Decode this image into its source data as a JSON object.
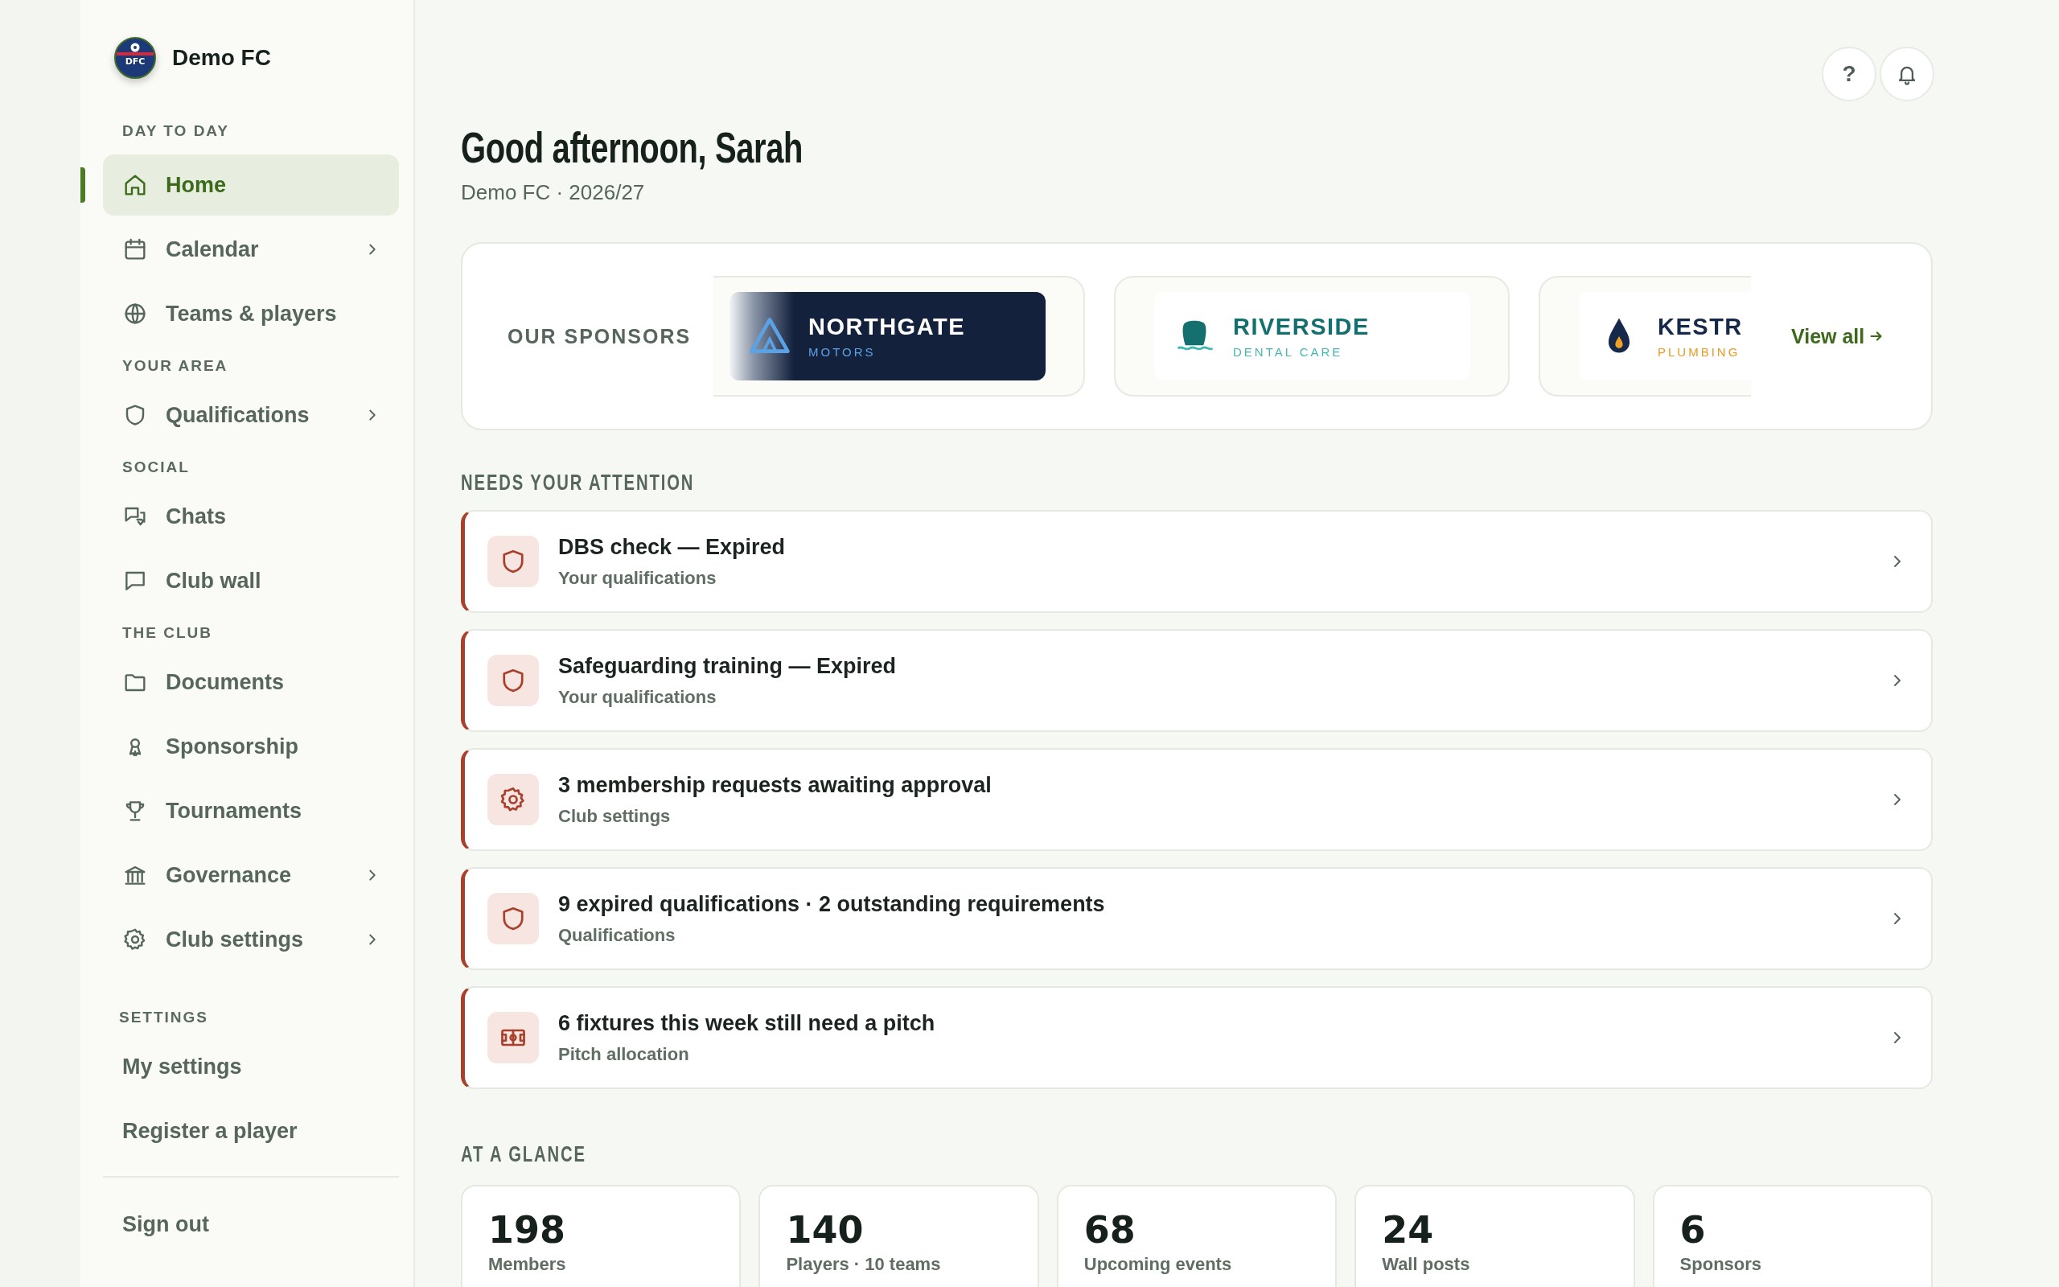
{
  "club": {
    "name": "Demo FC",
    "badge_text": "DFC"
  },
  "nav_sections": [
    {
      "heading": "DAY TO DAY",
      "items": [
        {
          "label": "Home",
          "selected": true,
          "has_submenu": false
        },
        {
          "label": "Calendar",
          "selected": false,
          "has_submenu": true
        },
        {
          "label": "Teams & players",
          "selected": false,
          "has_submenu": false
        }
      ]
    },
    {
      "heading": "YOUR AREA",
      "items": [
        {
          "label": "Qualifications",
          "selected": false,
          "has_submenu": true
        }
      ]
    },
    {
      "heading": "SOCIAL",
      "items": [
        {
          "label": "Chats",
          "selected": false,
          "has_submenu": false
        },
        {
          "label": "Club wall",
          "selected": false,
          "has_submenu": false
        }
      ]
    },
    {
      "heading": "THE CLUB",
      "items": [
        {
          "label": "Documents",
          "selected": false,
          "has_submenu": false
        },
        {
          "label": "Sponsorship",
          "selected": false,
          "has_submenu": false
        },
        {
          "label": "Tournaments",
          "selected": false,
          "has_submenu": false
        },
        {
          "label": "Governance",
          "selected": false,
          "has_submenu": true
        },
        {
          "label": "Club settings",
          "selected": false,
          "has_submenu": true
        }
      ]
    },
    {
      "heading": "SETTINGS",
      "items": [
        {
          "label": "My settings",
          "selected": false,
          "has_submenu": false
        },
        {
          "label": "Register a player",
          "selected": false,
          "has_submenu": false
        }
      ]
    }
  ],
  "sign_out": {
    "label": "Sign out"
  },
  "top_actions": {
    "help_label": "?"
  },
  "header": {
    "greeting": "Good afternoon, Sarah",
    "subtitle": "Demo FC · 2026/27"
  },
  "sponsors": {
    "heading": "OUR SPONSORS",
    "view_all": "View all",
    "items": [
      {
        "kind": "dark",
        "name": "NORTHGATE",
        "tagline": "MOTORS"
      },
      {
        "kind": "light",
        "name": "RIVERSIDE",
        "tagline": "DENTAL CARE"
      },
      {
        "kind": "light",
        "name": "KESTR",
        "tagline": "PLUMBING"
      }
    ]
  },
  "attention": {
    "heading": "NEEDS YOUR ATTENTION",
    "items": [
      {
        "title": "DBS check — Expired",
        "subtitle": "Your qualifications"
      },
      {
        "title": "Safeguarding training — Expired",
        "subtitle": "Your qualifications"
      },
      {
        "title": "3 membership requests awaiting approval",
        "subtitle": "Club settings"
      },
      {
        "title": "9 expired qualifications · 2 outstanding requirements",
        "subtitle": "Qualifications"
      },
      {
        "title": "6 fixtures this week still need a pitch",
        "subtitle": "Pitch allocation"
      }
    ]
  },
  "glance": {
    "heading": "AT A GLANCE",
    "stats": [
      {
        "value": "198",
        "label": "Members"
      },
      {
        "value": "140",
        "label": "Players · 10 teams"
      },
      {
        "value": "68",
        "label": "Upcoming events"
      },
      {
        "value": "24",
        "label": "Wall posts"
      },
      {
        "value": "6",
        "label": "Sponsors"
      }
    ]
  }
}
